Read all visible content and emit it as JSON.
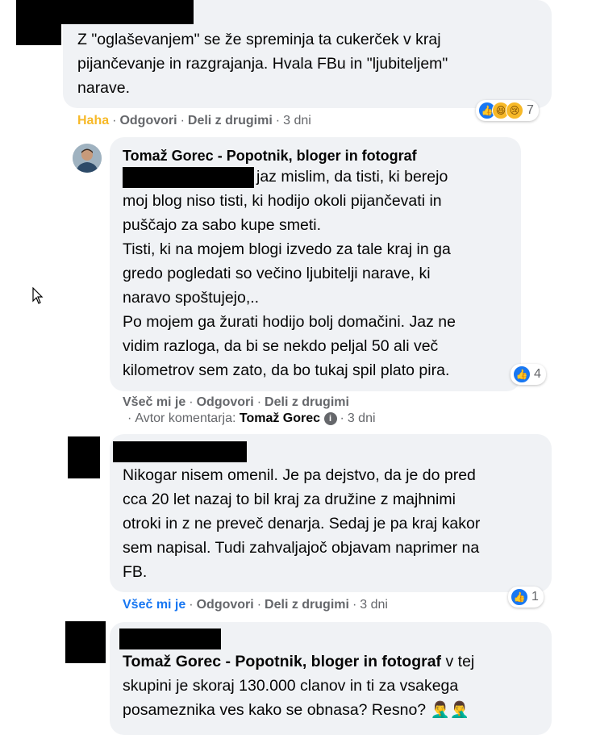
{
  "comments": [
    {
      "text": "Z \"oglaševanjem\" se že spreminja ta cukerček v kraj\npijančevanje in razgrajanja. Hvala FBu in \"ljubiteljem\"\nnarave.",
      "reaction_label": "Haha",
      "reply_label": "Odgovori",
      "share_label": "Deli z drugimi",
      "time": "3 dni",
      "reaction_count": "7",
      "reaction_icons": [
        "like-icon",
        "haha-icon",
        "sad-icon"
      ]
    },
    {
      "author": "Tomaž Gorec - Popotnik, bloger in fotograf",
      "text_line1": "jaz mislim, da tisti, ki berejo",
      "text_rest": "moj blog niso tisti, ki hodijo okoli pijančevati in\npuščajo za sabo kupe smeti.\nTisti, ki na mojem blogi izvedo za tale kraj in ga\ngredo pogledati so večino ljubitelji narave, ki\nnaravo spoštujejo,..\nPo mojem ga žurati hodijo bolj domačini. Jaz ne\nvidim razloga, da bi se nekdo peljal 50 ali več\nkilometrov sem zato, da bo tukaj spil plato pira.",
      "like_label": "Všeč mi je",
      "reply_label": "Odgovori",
      "share_label": "Deli z drugimi",
      "author_tag_label": "Avtor komentarja:",
      "author_tag_name": "Tomaž Gorec",
      "time": "3 dni",
      "reaction_count": "4",
      "reaction_icons": [
        "like-icon"
      ]
    },
    {
      "text": "Nikogar nisem omenil. Je pa dejstvo, da je do pred\ncca 20 let nazaj to bil kraj za družine z majhnimi\notroki in z ne preveč denarja. Sedaj je pa kraj kakor\nsem napisal. Tudi zahvaljajoč objavam naprimer na\nFB.",
      "like_label": "Všeč mi je",
      "reply_label": "Odgovori",
      "share_label": "Deli z drugimi",
      "time": "3 dni",
      "reaction_count": "1",
      "reaction_icons": [
        "like-icon"
      ]
    },
    {
      "mention": "Tomaž Gorec - Popotnik, bloger in fotograf",
      "text_after_mention": " v tej",
      "text_rest": "skupini je skoraj 130.000 clanov in ti za vsakega\nposameznika ves kako se obnasa? Resno?",
      "emoji": "🤦‍♂️🤦‍♂️"
    }
  ],
  "colors": {
    "bubble": "#f0f2f5",
    "text": "#050505",
    "meta": "#65676b",
    "like_blue": "#1877f2",
    "haha_yellow": "#f7b928"
  }
}
